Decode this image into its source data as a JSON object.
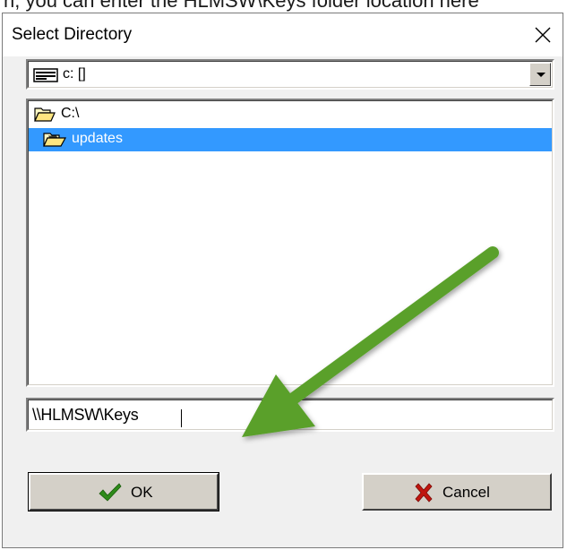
{
  "context_text": "n, you can enter the HLMSW\\Keys folder location here",
  "dialog": {
    "title": "Select Directory",
    "close_label": "×"
  },
  "drive_combo": {
    "value": "c: []",
    "icon": "drive-icon"
  },
  "directory_list": {
    "items": [
      {
        "label": "C:\\",
        "icon": "open-folder-icon",
        "selected": false
      },
      {
        "label": "updates",
        "icon": "open-folder-icon",
        "selected": true
      }
    ]
  },
  "path_input": {
    "value": "\\\\HLMSW\\Keys"
  },
  "buttons": {
    "ok_label": "OK",
    "cancel_label": "Cancel"
  },
  "colors": {
    "selection": "#3399ff",
    "arrow": "#5aa02c",
    "ok_check": "#2e8b1a",
    "cancel_x": "#c0160f"
  },
  "annotation": {
    "icon": "green-arrow-annotation"
  }
}
